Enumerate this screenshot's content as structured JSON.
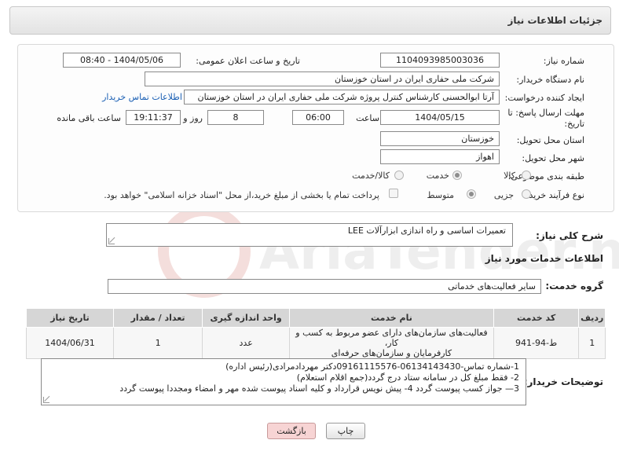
{
  "header": {
    "title": "جزئیات اطلاعات نیاز"
  },
  "fields": {
    "need_number": {
      "label": "شماره نیاز:",
      "value": "1104093985003036"
    },
    "announce_datetime": {
      "label": "تاریخ و ساعت اعلان عمومی:",
      "value": "1404/05/06 - 08:40"
    },
    "buyer_org": {
      "label": "نام دستگاه خریدار:",
      "value": "شرکت ملی حفاری ایران در استان خوزستان"
    },
    "requester": {
      "label": "ایجاد کننده درخواست:",
      "value": "آرتا ابوالحسنی کارشناس کنترل پروژه شرکت ملی حفاری ایران در استان خوزستان"
    },
    "buyer_contact_link": "اطلاعات تماس خریدار",
    "deadline": {
      "label_line1": "مهلت ارسال پاسخ: تا",
      "label_line2": "تاریخ:",
      "date": "1404/05/15",
      "time_label": "ساعت",
      "time": "06:00",
      "days": "8",
      "days_label": "روز و",
      "remaining": "19:11:37",
      "remaining_label": "ساعت باقی مانده"
    },
    "delivery_province": {
      "label": "استان محل تحویل:",
      "value": "خوزستان"
    },
    "delivery_city": {
      "label": "شهر محل تحویل:",
      "value": "اهواز"
    },
    "category": {
      "label": "طبقه بندی موضوعی:",
      "options": [
        "کالا",
        "خدمت",
        "کالا/خدمت"
      ],
      "selected": "خدمت"
    },
    "process_type": {
      "label": "نوع فرآیند خرید :",
      "options": [
        "جزیی",
        "متوسط"
      ],
      "selected": "متوسط",
      "payment_note": "پرداخت تمام یا بخشی از مبلغ خرید،از محل \"اسناد خزانه اسلامی\" خواهد بود."
    }
  },
  "general_description": {
    "label": "شرح کلی نیاز:",
    "value": "تعمیرات اساسی و راه اندازی ابزارآلات  LEE"
  },
  "services_section": {
    "title": "اطلاعات خدمات مورد نیاز",
    "group_label": "گروه خدمت:",
    "group_value": "سایر فعالیت‌های خدماتی"
  },
  "table": {
    "headers": [
      "ردیف",
      "کد خدمت",
      "نام خدمت",
      "واحد اندازه گیری",
      "تعداد / مقدار",
      "تاریخ نیاز"
    ],
    "rows": [
      {
        "row": "1",
        "code": "ط-94-941",
        "name_line1": "فعالیت‌های سازمان‌های دارای عضو مربوط به کسب و کار،",
        "name_line2": "کارفرمایان و سازمان‌های حرفه‌ای",
        "unit": "عدد",
        "qty": "1",
        "date": "1404/06/31"
      }
    ]
  },
  "buyer_notes": {
    "label": "توضیحات خریدار:",
    "lines": [
      "1-شماره تماس-06134143430-09161115576دکتر مهردادمرادی(رئیس اداره)",
      "2- فقط مبلغ کل در سامانه ستاد درج گردد(جمع اقلام استعلام)",
      "3— جواز کسب  پیوست گردد 4- پیش نویس قرارداد  و کلیه اسناد پیوست شده مهر و امضاء ومجددا پیوست  گردد"
    ]
  },
  "buttons": {
    "print": "چاپ",
    "back": "بازگشت"
  },
  "watermark": "AriaTender.neT"
}
